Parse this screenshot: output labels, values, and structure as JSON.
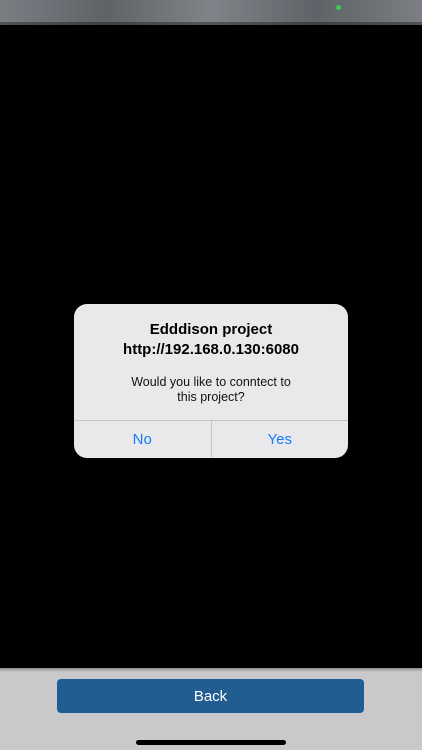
{
  "alert": {
    "title": "Edddison project\nhttp://192.168.0.130:6080",
    "message": "Would you like to conntect to\nthis project?",
    "no_label": "No",
    "yes_label": "Yes",
    "button_color": "#157efb"
  },
  "footer": {
    "back_label": "Back",
    "button_color": "#215d91"
  },
  "status_bar": {
    "indicator_color": "#31d158"
  }
}
